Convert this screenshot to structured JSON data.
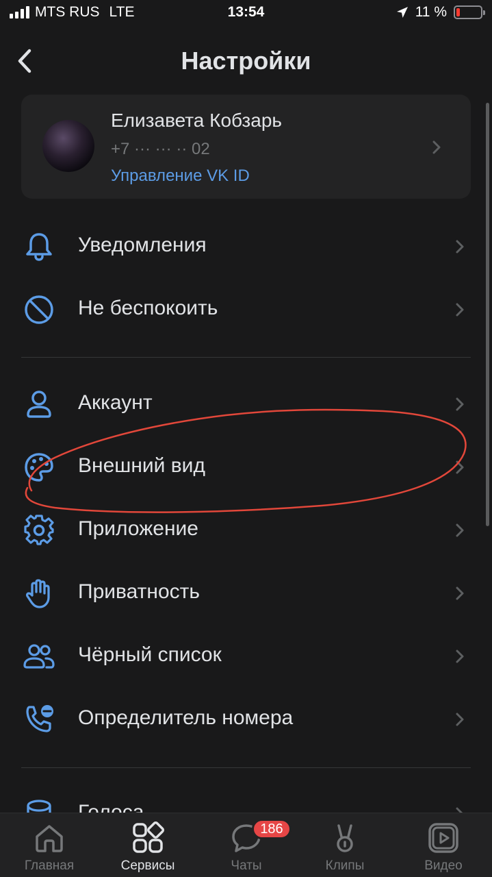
{
  "status_bar": {
    "carrier": "MTS RUS",
    "network": "LTE",
    "time": "13:54",
    "battery_text": "11 %",
    "battery_level": 0.11
  },
  "header": {
    "title": "Настройки",
    "back_icon": "chevron-left-icon"
  },
  "profile": {
    "name": "Елизавета Кобзарь",
    "phone": "+7 ··· ··· ·· 02",
    "manage_link": "Управление VK ID"
  },
  "sections": [
    {
      "items": [
        {
          "label": "Уведомления",
          "icon": "bell-icon"
        },
        {
          "label": "Не беспокоить",
          "icon": "do-not-disturb-icon"
        }
      ]
    },
    {
      "items": [
        {
          "label": "Аккаунт",
          "icon": "user-icon"
        },
        {
          "label": "Внешний вид",
          "icon": "palette-icon"
        },
        {
          "label": "Приложение",
          "icon": "gear-icon"
        },
        {
          "label": "Приватность",
          "icon": "hand-icon"
        },
        {
          "label": "Чёрный список",
          "icon": "users-icon"
        },
        {
          "label": "Определитель номера",
          "icon": "caller-id-icon"
        }
      ]
    },
    {
      "items": [
        {
          "label": "Голоса",
          "icon": "coins-icon"
        }
      ]
    }
  ],
  "tabbar": {
    "tabs": [
      {
        "label": "Главная",
        "icon": "home-icon",
        "active": false
      },
      {
        "label": "Сервисы",
        "icon": "services-icon",
        "active": true
      },
      {
        "label": "Чаты",
        "icon": "chat-icon",
        "active": false,
        "badge": "186"
      },
      {
        "label": "Клипы",
        "icon": "clips-icon",
        "active": false
      },
      {
        "label": "Видео",
        "icon": "video-icon",
        "active": false
      }
    ]
  },
  "colors": {
    "background": "#19191a",
    "accent": "#5c9ce6",
    "annotation": "#e2473a",
    "badge": "#e64646"
  }
}
